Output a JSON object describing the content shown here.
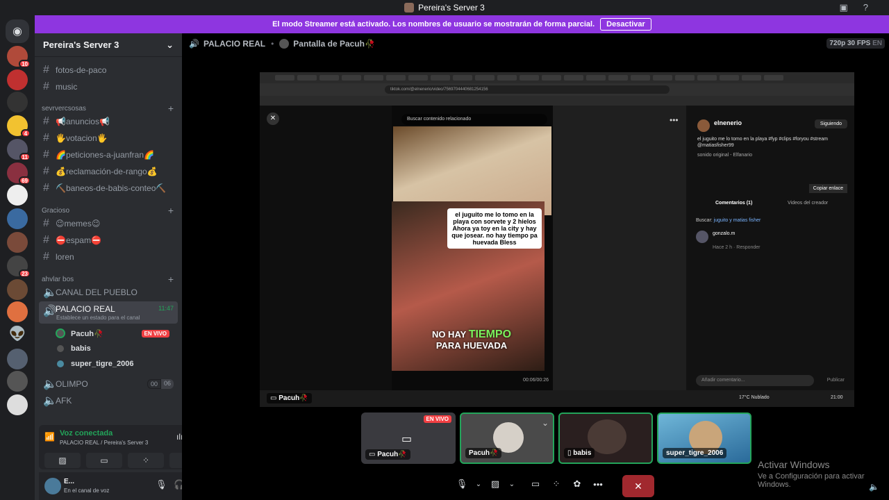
{
  "window": {
    "title": "Pereira's Server 3"
  },
  "banner": {
    "text": "El modo Streamer está activado. Los nombres de usuario se mostrarán de forma parcial.",
    "button": "Desactivar"
  },
  "server_badges": [
    "10",
    "4",
    "11",
    "69",
    "23"
  ],
  "sidebar": {
    "server_name": "Pereira's Server 3",
    "channels_top": [
      "fotos-de-paco",
      "music"
    ],
    "categories": {
      "c1": "sevrvercsosas",
      "c2": "Gracioso",
      "c3": "ahvlar bos"
    },
    "cat1_channels": [
      "📢anuncios📢",
      "🖐votacion🖐",
      "🌈peticiones-a-juanfran🌈",
      "💰reclamación-de-rango💰",
      "⛏️baneos-de-babis-conteo⛏️"
    ],
    "cat2_channels": [
      "😉memes😉",
      "⛔espam⛔",
      "loren"
    ],
    "voice": {
      "v1": "CANAL DEL PUEBLO",
      "v2": "PALACIO REAL",
      "v2_status": "Establece un estado para el canal",
      "v2_time": "11:47",
      "members": [
        "Pacuh🥀",
        "babis",
        "super_tigre_2006"
      ],
      "live": "EN VIVO",
      "v3": "OLIMPO",
      "v3_count_a": "00",
      "v3_count_b": "06",
      "v4": "AFK"
    }
  },
  "voice_panel": {
    "title": "Voz conectada",
    "subtitle": "PALACIO REAL / Pereira's Server 3"
  },
  "user_panel": {
    "name": "E...",
    "status": "En el canal de voz"
  },
  "topbar": {
    "channel": "PALACIO REAL",
    "screen": "Pantalla de Pacuh🥀",
    "quality": "720p 30 FPS",
    "lang": "EN"
  },
  "stream": {
    "url": "tiktok.com/@elnenerio/video/7569704440681254156",
    "search": "Buscar contenido relacionado",
    "caption": "el juguito me lo tomo en la playa con sorvete y 2 hielos Ahora ya toy en la city y hay que josear. no hay tiempo pa huevada Bless",
    "big_caption_1": "NO HAY",
    "big_caption_2": "TIEMPO",
    "big_caption_3": "PARA HUEVADA",
    "author": "elnenerio",
    "follow": "Siguiendo",
    "description": "el juguito me lo tomo en la playa #fyp #clips #foryou #stream @matiasfisher99",
    "sound": "sonido original - Elfanario",
    "copy_link": "Copiar enlace",
    "tab_comments": "Comentarios (1)",
    "tab_creator": "Videos del creador",
    "search_label": "Buscar:",
    "search_term": "juguito y matias fisher",
    "commenter": "gonzalo.m",
    "comment_meta": "Hace 2 h",
    "reply": "Responder",
    "add_comment": "Añadir comentario...",
    "publish": "Publicar",
    "sharer": "Pacuh🥀",
    "time": "00:06/00:26",
    "weather": "17°C Nublado",
    "clock": "21:00"
  },
  "tiles": [
    {
      "name": "Pacuh🥀",
      "live": "EN VIVO"
    },
    {
      "name": "Pacuh🥀"
    },
    {
      "name": "babis"
    },
    {
      "name": "super_tigre_2006"
    }
  ],
  "watermark": {
    "title": "Activar Windows",
    "subtitle": "Ve a Configuración para activar Windows."
  },
  "colors": {
    "accent": "#5865f2",
    "banner": "#8e36e0",
    "speaking": "#23a55a",
    "live": "#f23f43"
  }
}
